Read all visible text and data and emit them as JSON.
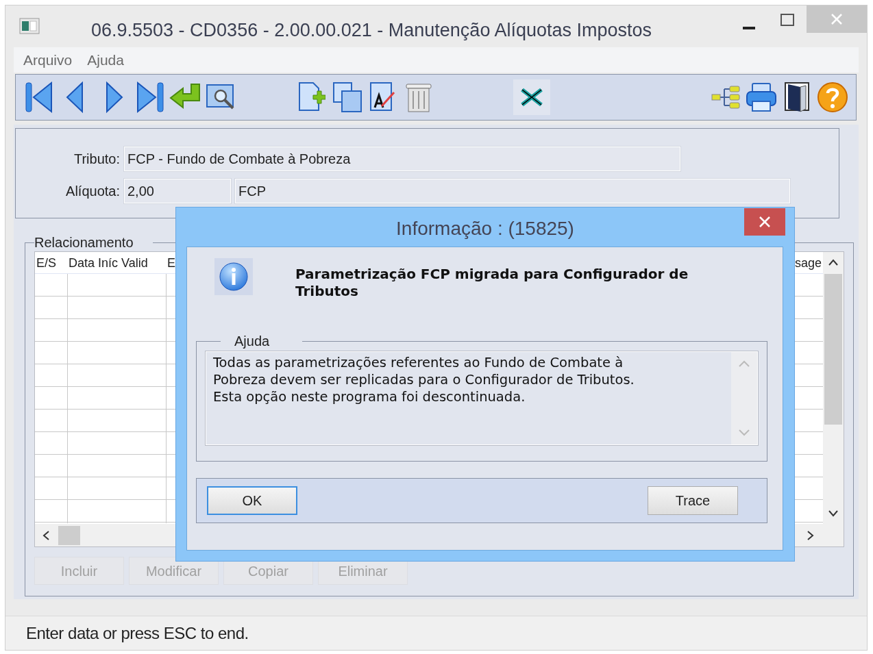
{
  "window": {
    "title": "06.9.5503 - CD0356 - 2.00.00.021 - Manutenção Alíquotas Impostos"
  },
  "menu": [
    "Arquivo",
    "Ajuda"
  ],
  "form": {
    "tributo": {
      "label": "Tributo:",
      "value": "FCP - Fundo de Combate à Pobreza"
    },
    "aliquota": {
      "label": "Alíquota:",
      "value": "2,00",
      "description": "FCP"
    }
  },
  "relacionamento": {
    "title": "Relacionamento",
    "columns": [
      "E/S",
      "Data Iníc Valid",
      "E"
    ],
    "last_column": "sage",
    "buttons": [
      {
        "label": "Incluir",
        "disabled": true
      },
      {
        "label": "Modificar",
        "disabled": true
      },
      {
        "label": "Copiar",
        "disabled": true
      },
      {
        "label": "Eliminar",
        "disabled": true
      }
    ]
  },
  "dialog": {
    "title": "Informação : (15825)",
    "message": "Parametrização FCP migrada para Configurador de Tributos",
    "help_title": "Ajuda",
    "help_text": "Todas as parametrizações referentes ao Fundo de Combate à\nPobreza devem ser replicadas para o Configurador de Tributos.\nEsta opção neste programa foi descontinuada.",
    "buttons": [
      {
        "label": "OK",
        "focused": true
      },
      {
        "label": "Trace",
        "focused": false
      }
    ]
  },
  "status_bar": "Enter data or press ESC to end."
}
